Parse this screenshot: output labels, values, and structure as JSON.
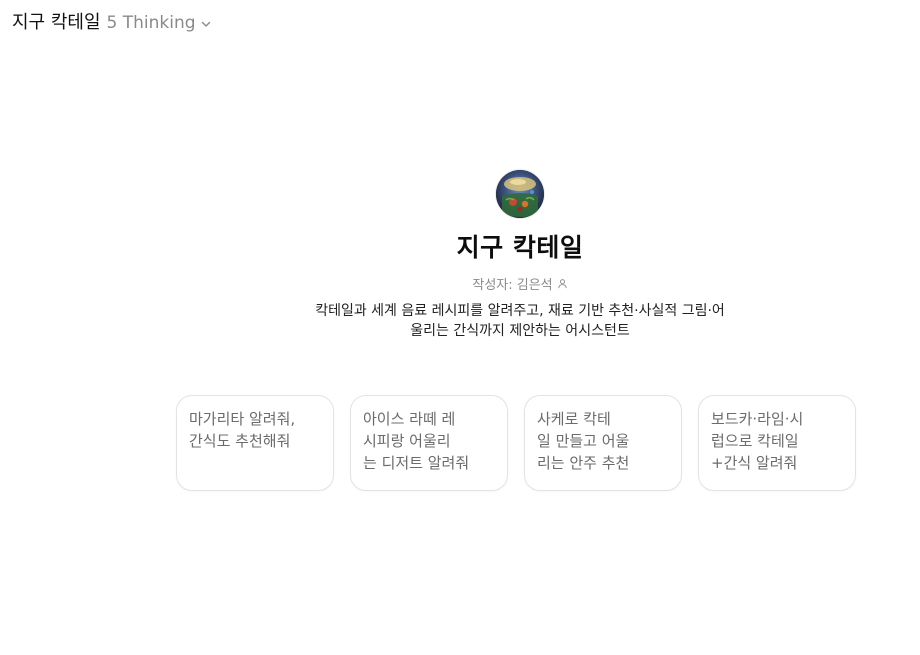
{
  "header": {
    "gpt_name": "지구 칵테일",
    "model_label": "5 Thinking",
    "model_icon": "chevron-down-icon"
  },
  "profile": {
    "title": "지구 칵테일",
    "author": "작성자: 김은석",
    "author_icon": "person-icon",
    "description": "칵테일과 세계 음료 레시피를 알려주고, 재료 기반 추천·사실적 그림·어\n울리는 간식까지 제안하는 어시스턴트"
  },
  "starters": [
    {
      "label": "마가리타 알려줘,\n간식도 추천해줘"
    },
    {
      "label": "아이스 라떼 레\n시피랑 어울리\n는 디저트 알려줘"
    },
    {
      "label": "사케로 칵테\n일 만들고 어울\n리는 안주 추천"
    },
    {
      "label": "보드카·라임·시\n럽으로 칵테일\n+간식 알려줘"
    }
  ]
}
